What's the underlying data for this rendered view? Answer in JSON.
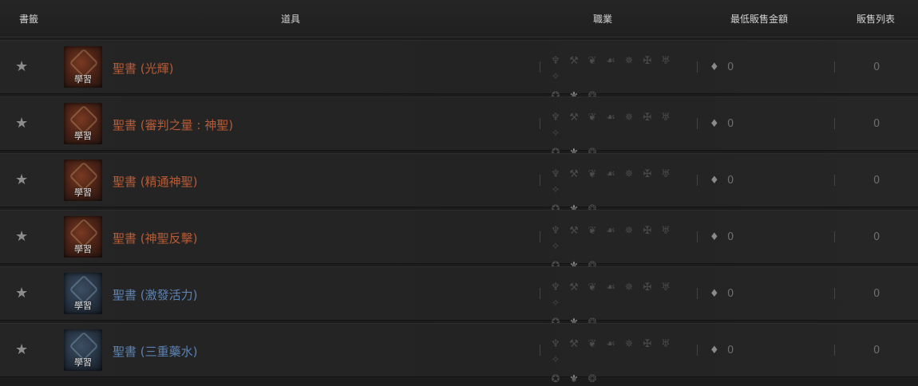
{
  "header": {
    "favorites": "書籤",
    "item": "道具",
    "class": "職業",
    "min_price": "最低販售金額",
    "listings": "販售列表"
  },
  "rows": [
    {
      "name": "聖書 (光輝)",
      "tag": "學習",
      "color": "#b85a34",
      "price": "0",
      "listings": "0"
    },
    {
      "name": "聖書 (審判之量 : 神聖)",
      "tag": "學習",
      "color": "#b85a34",
      "price": "0",
      "listings": "0"
    },
    {
      "name": "聖書 (精通神聖)",
      "tag": "學習",
      "color": "#b85a34",
      "price": "0",
      "listings": "0"
    },
    {
      "name": "聖書 (神聖反擊)",
      "tag": "學習",
      "color": "#b85a34",
      "price": "0",
      "listings": "0"
    },
    {
      "name": "聖書 (激發活力)",
      "tag": "學習",
      "color": "#5b82b3",
      "price": "0",
      "listings": "0"
    },
    {
      "name": "聖書 (三重藥水)",
      "tag": "學習",
      "color": "#5b82b3",
      "price": "0",
      "listings": "0"
    }
  ],
  "icons": {
    "favorite": "star-icon",
    "gem": "gem-icon",
    "class_icons": [
      "warrior-icon",
      "knight-icon",
      "archer-icon",
      "assassin-icon",
      "mage-icon",
      "warlord-icon",
      "sorcerer-icon",
      "spear-icon",
      "priest-icon",
      "paladin-icon",
      "summoner-icon"
    ]
  }
}
